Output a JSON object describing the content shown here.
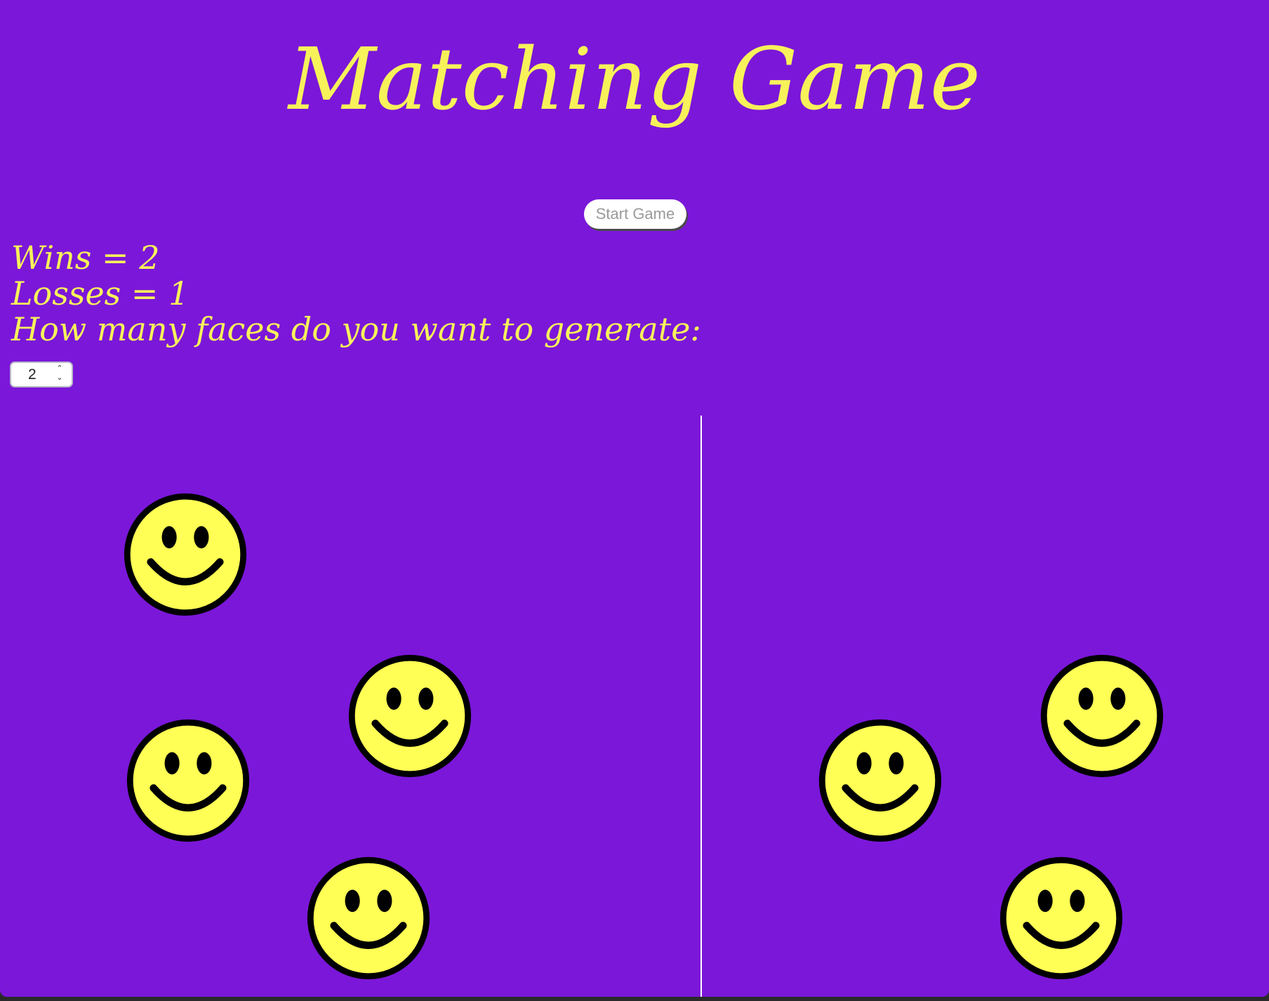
{
  "title": "Matching Game",
  "start_button_label": "Start Game",
  "stats": {
    "wins_text": "Wins = 2",
    "losses_text": "Losses = 1",
    "prompt_text": "How many faces do you want to generate:"
  },
  "face_count_value": "2",
  "colors": {
    "background": "#7b17d9",
    "text": "#f7f25a",
    "face_fill": "#ffff55",
    "face_outline": "#000000"
  },
  "icons": {
    "face": "smiley-face-icon"
  },
  "faces": {
    "left_count": 4,
    "right_count": 3
  }
}
